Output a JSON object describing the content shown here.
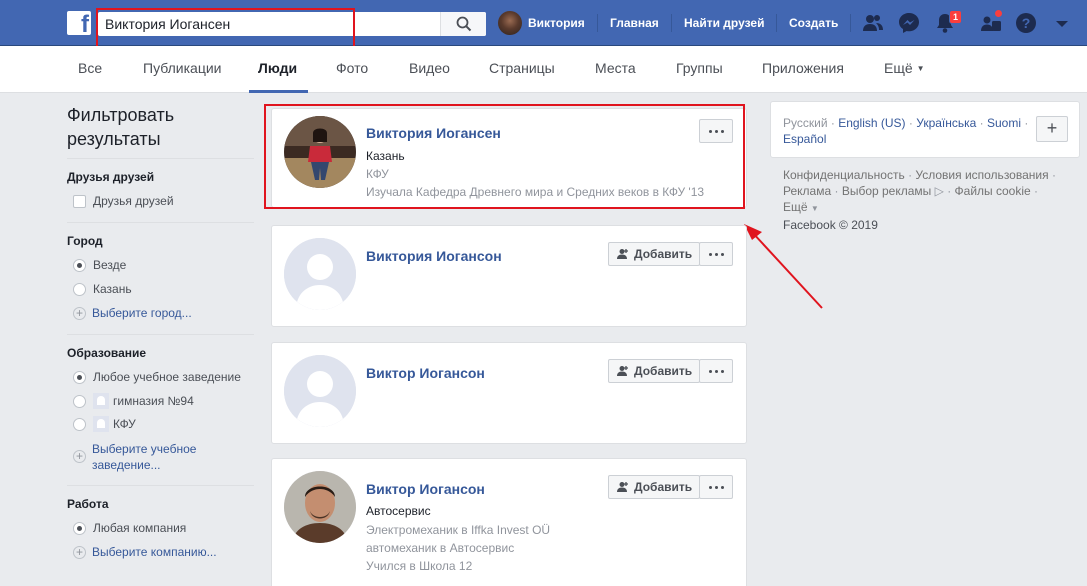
{
  "topbar": {
    "search_value": "Виктория Иогансен",
    "user_name": "Виктория",
    "nav": [
      "Главная",
      "Найти друзей",
      "Создать"
    ],
    "notifications_count": "1",
    "colors": {
      "brand": "#4267b2",
      "highlight": "#e0141e"
    }
  },
  "tabs": [
    {
      "label": "Все"
    },
    {
      "label": "Публикации"
    },
    {
      "label": "Люди",
      "active": true
    },
    {
      "label": "Фото"
    },
    {
      "label": "Видео"
    },
    {
      "label": "Страницы"
    },
    {
      "label": "Места"
    },
    {
      "label": "Группы"
    },
    {
      "label": "Приложения"
    },
    {
      "label": "Ещё"
    }
  ],
  "sidebar": {
    "title_line1": "Фильтровать",
    "title_line2": "результаты",
    "friends": {
      "title": "Друзья друзей",
      "option": "Друзья друзей"
    },
    "city": {
      "title": "Город",
      "options": [
        "Везде",
        "Казань"
      ],
      "choose": "Выберите город..."
    },
    "education": {
      "title": "Образование",
      "options": [
        "Любое учебное заведение",
        "гимназия №94",
        "КФУ"
      ],
      "choose_line1": "Выберите учебное",
      "choose_line2": "заведение..."
    },
    "work": {
      "title": "Работа",
      "options": [
        "Любая компания"
      ],
      "choose": "Выберите компанию..."
    }
  },
  "results": [
    {
      "name": "Виктория Иогансен",
      "lines": [
        "Казань",
        "КФУ",
        "Изучала Кафедра Древнего мира и Средних веков в КФУ '13"
      ]
    },
    {
      "name": "Виктория Иогансон",
      "add_label": "Добавить",
      "lines": []
    },
    {
      "name": "Виктор Иогансон",
      "add_label": "Добавить",
      "lines": []
    },
    {
      "name": "Виктор Иогансон",
      "add_label": "Добавить",
      "lines": [
        "Автосервис",
        "Электромеханик в Iffka Invest OÜ",
        "автомеханик в Автосервис",
        "Учился в Школа 12"
      ]
    }
  ],
  "right": {
    "languages": [
      "Русский",
      "English (US)",
      "Українська",
      "Suomi",
      "Español"
    ],
    "footer": {
      "l1a": "Конфиденциальность",
      "l1b": "Условия использования",
      "l2a": "Реклама",
      "l2b": "Выбор рекламы",
      "l2c": "Файлы cookie",
      "l3": "Ещё",
      "copyright": "Facebook © 2019"
    }
  }
}
